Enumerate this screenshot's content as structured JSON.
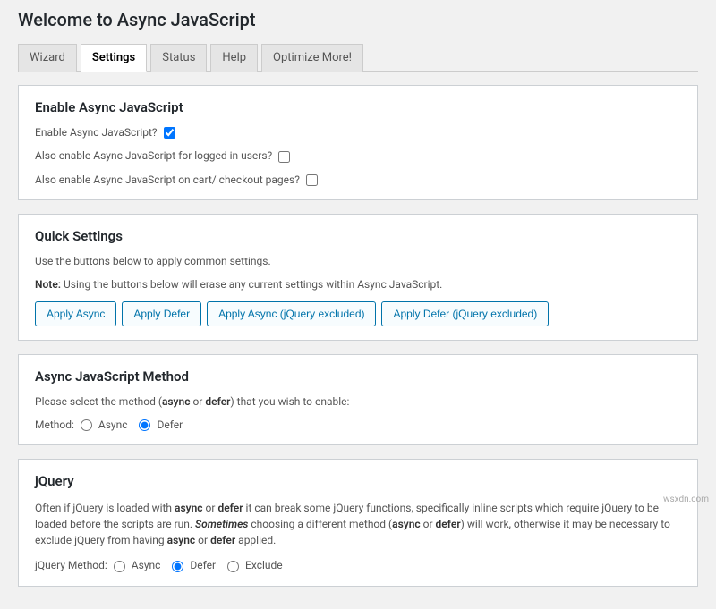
{
  "page_title": "Welcome to Async JavaScript",
  "tabs": [
    "Wizard",
    "Settings",
    "Status",
    "Help",
    "Optimize More!"
  ],
  "active_tab": 1,
  "enable_section": {
    "heading": "Enable Async JavaScript",
    "row1": "Enable Async JavaScript?",
    "row1_checked": true,
    "row2": "Also enable Async JavaScript for logged in users?",
    "row2_checked": false,
    "row3": "Also enable Async JavaScript on cart/ checkout pages?",
    "row3_checked": false
  },
  "quick_settings": {
    "heading": "Quick Settings",
    "intro": "Use the buttons below to apply common settings.",
    "note_label": "Note:",
    "note_text": " Using the buttons below will erase any current settings within Async JavaScript.",
    "buttons": [
      "Apply Async",
      "Apply Defer",
      "Apply Async (jQuery excluded)",
      "Apply Defer (jQuery excluded)"
    ]
  },
  "method_section": {
    "heading": "Async JavaScript Method",
    "intro_pre": "Please select the method (",
    "intro_bold1": "async",
    "intro_mid": " or ",
    "intro_bold2": "defer",
    "intro_post": ") that you wish to enable:",
    "label": "Method:",
    "opt_async": "Async",
    "opt_defer": "Defer",
    "selected": "defer"
  },
  "jquery_section": {
    "heading": "jQuery",
    "p_pre": "Often if jQuery is loaded with ",
    "p_b1": "async",
    "p_or1": " or ",
    "p_b2": "defer",
    "p_mid1": " it can break some jQuery functions, specifically inline scripts which require jQuery to be loaded before the scripts are run. ",
    "p_b3": "Sometimes",
    "p_mid2": " choosing a different method (",
    "p_b4": "async",
    "p_or2": " or ",
    "p_b5": "defer",
    "p_mid3": ") will work, otherwise it may be necessary to exclude jQuery from having ",
    "p_b6": "async",
    "p_or3": " or ",
    "p_b7": "defer",
    "p_end": " applied.",
    "label": "jQuery Method:",
    "opt_async": "Async",
    "opt_defer": "Defer",
    "opt_exclude": "Exclude",
    "selected": "defer"
  },
  "watermark": "wsxdn.com"
}
